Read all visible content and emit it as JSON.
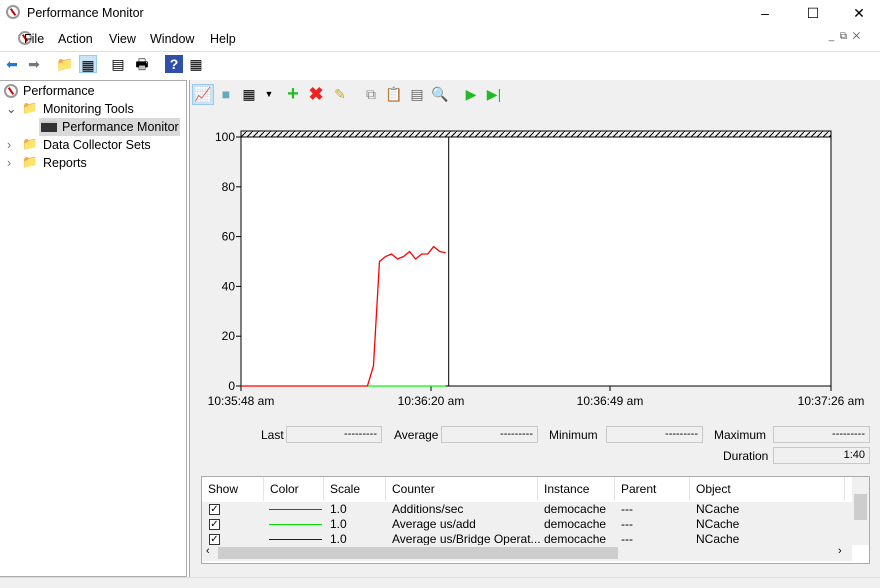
{
  "window": {
    "title": "Performance Monitor",
    "icon": "perfmon-icon"
  },
  "menu": [
    "File",
    "Action",
    "View",
    "Window",
    "Help"
  ],
  "tree": {
    "root": "Performance",
    "items": [
      "Monitoring Tools",
      "Performance Monitor",
      "Data Collector Sets",
      "Reports"
    ],
    "selected": "Performance Monitor"
  },
  "perf_toolbar": [
    "view-graph-icon",
    "view-histogram-icon",
    "change-graph-type-icon",
    "add-counter-icon",
    "delete-counter-icon",
    "highlight-icon",
    "copy-properties-icon",
    "paste-counter-list-icon",
    "properties-icon",
    "zoom-icon",
    "unfreeze-display-icon",
    "update-data-icon"
  ],
  "stats": {
    "last_label": "Last",
    "last": "---------",
    "average_label": "Average",
    "average": "---------",
    "minimum_label": "Minimum",
    "minimum": "---------",
    "maximum_label": "Maximum",
    "maximum": "---------",
    "duration_label": "Duration",
    "duration": "1:40"
  },
  "chart_data": {
    "type": "line",
    "ylim": [
      0,
      100
    ],
    "yticks": [
      "0",
      "20",
      "40",
      "60",
      "80",
      "100"
    ],
    "xticks": [
      "10:35:48 am",
      "10:36:20 am",
      "10:36:49 am",
      "10:37:26 am"
    ],
    "xrange": [
      "10:35:48",
      "10:37:26"
    ],
    "series": [
      {
        "name": "Additions/sec",
        "color": "#ff0000",
        "x": [
          "10:35:48",
          "10:36:09",
          "10:36:10",
          "10:36:11",
          "10:36:12",
          "10:36:13",
          "10:36:14",
          "10:36:15",
          "10:36:16",
          "10:36:17",
          "10:36:18",
          "10:36:19",
          "10:36:20",
          "10:36:21",
          "10:36:22"
        ],
        "y": [
          0,
          0,
          8,
          50,
          52,
          53,
          51,
          52,
          54,
          51,
          53,
          53,
          56,
          54,
          53.5
        ]
      },
      {
        "name": "Average us/add",
        "color": "#00ff00",
        "x": [
          "10:36:09",
          "10:36:22"
        ],
        "y": [
          0,
          0
        ]
      }
    ],
    "time_bar": "10:36:22"
  },
  "table": {
    "headers": [
      "Show",
      "Color",
      "Scale",
      "Counter",
      "Instance",
      "Parent",
      "Object"
    ],
    "rows": [
      {
        "show": true,
        "color": "#ff0000",
        "scale": "1.0",
        "counter": "Additions/sec",
        "instance": "democache",
        "parent": "---",
        "object": "NCache"
      },
      {
        "show": true,
        "color": "#00e000",
        "scale": "1.0",
        "counter": "Average us/add",
        "instance": "democache",
        "parent": "---",
        "object": "NCache"
      },
      {
        "show": true,
        "color": "#0000ff",
        "scale": "1.0",
        "counter": "Average us/Bridge Operat...",
        "instance": "democache",
        "parent": "---",
        "object": "NCache"
      }
    ]
  }
}
